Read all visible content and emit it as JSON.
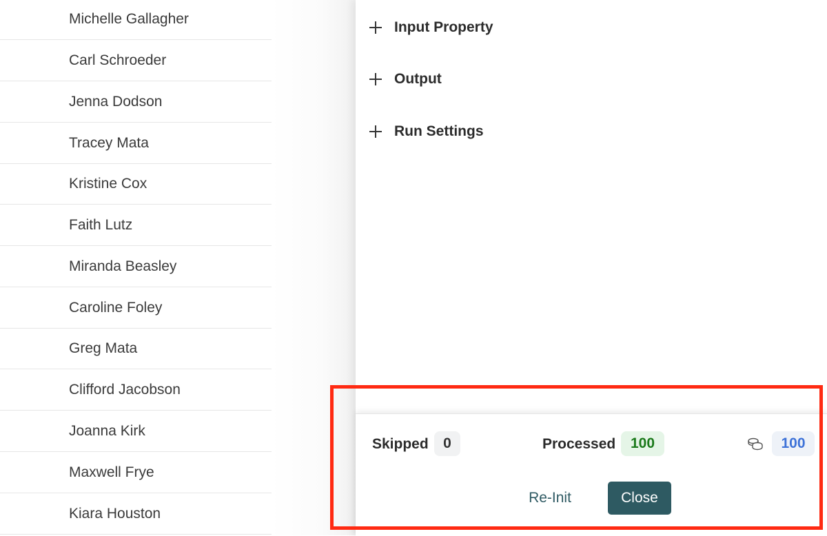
{
  "contacts": [
    {
      "name": "Michelle Gallagher"
    },
    {
      "name": "Carl Schroeder"
    },
    {
      "name": "Jenna Dodson"
    },
    {
      "name": "Tracey Mata"
    },
    {
      "name": "Kristine Cox"
    },
    {
      "name": "Faith Lutz"
    },
    {
      "name": "Miranda Beasley"
    },
    {
      "name": "Caroline Foley"
    },
    {
      "name": "Greg Mata"
    },
    {
      "name": "Clifford Jacobson"
    },
    {
      "name": "Joanna Kirk"
    },
    {
      "name": "Maxwell Frye"
    },
    {
      "name": "Kiara Houston"
    }
  ],
  "sections": [
    {
      "label": "Input Property",
      "icon": "plus-icon"
    },
    {
      "label": "Output",
      "icon": "plus-icon"
    },
    {
      "label": "Run Settings",
      "icon": "plus-icon"
    }
  ],
  "footer": {
    "skipped_label": "Skipped",
    "skipped_value": "0",
    "processed_label": "Processed",
    "processed_value": "100",
    "credits_icon": "coins-icon",
    "credits_value": "100",
    "reinit_label": "Re-Init",
    "close_label": "Close"
  },
  "colors": {
    "primary_button": "#2e5a62",
    "processed_badge_text": "#1b7a1b",
    "credits_badge_text": "#3d72d8",
    "highlight": "#ff2a12"
  }
}
